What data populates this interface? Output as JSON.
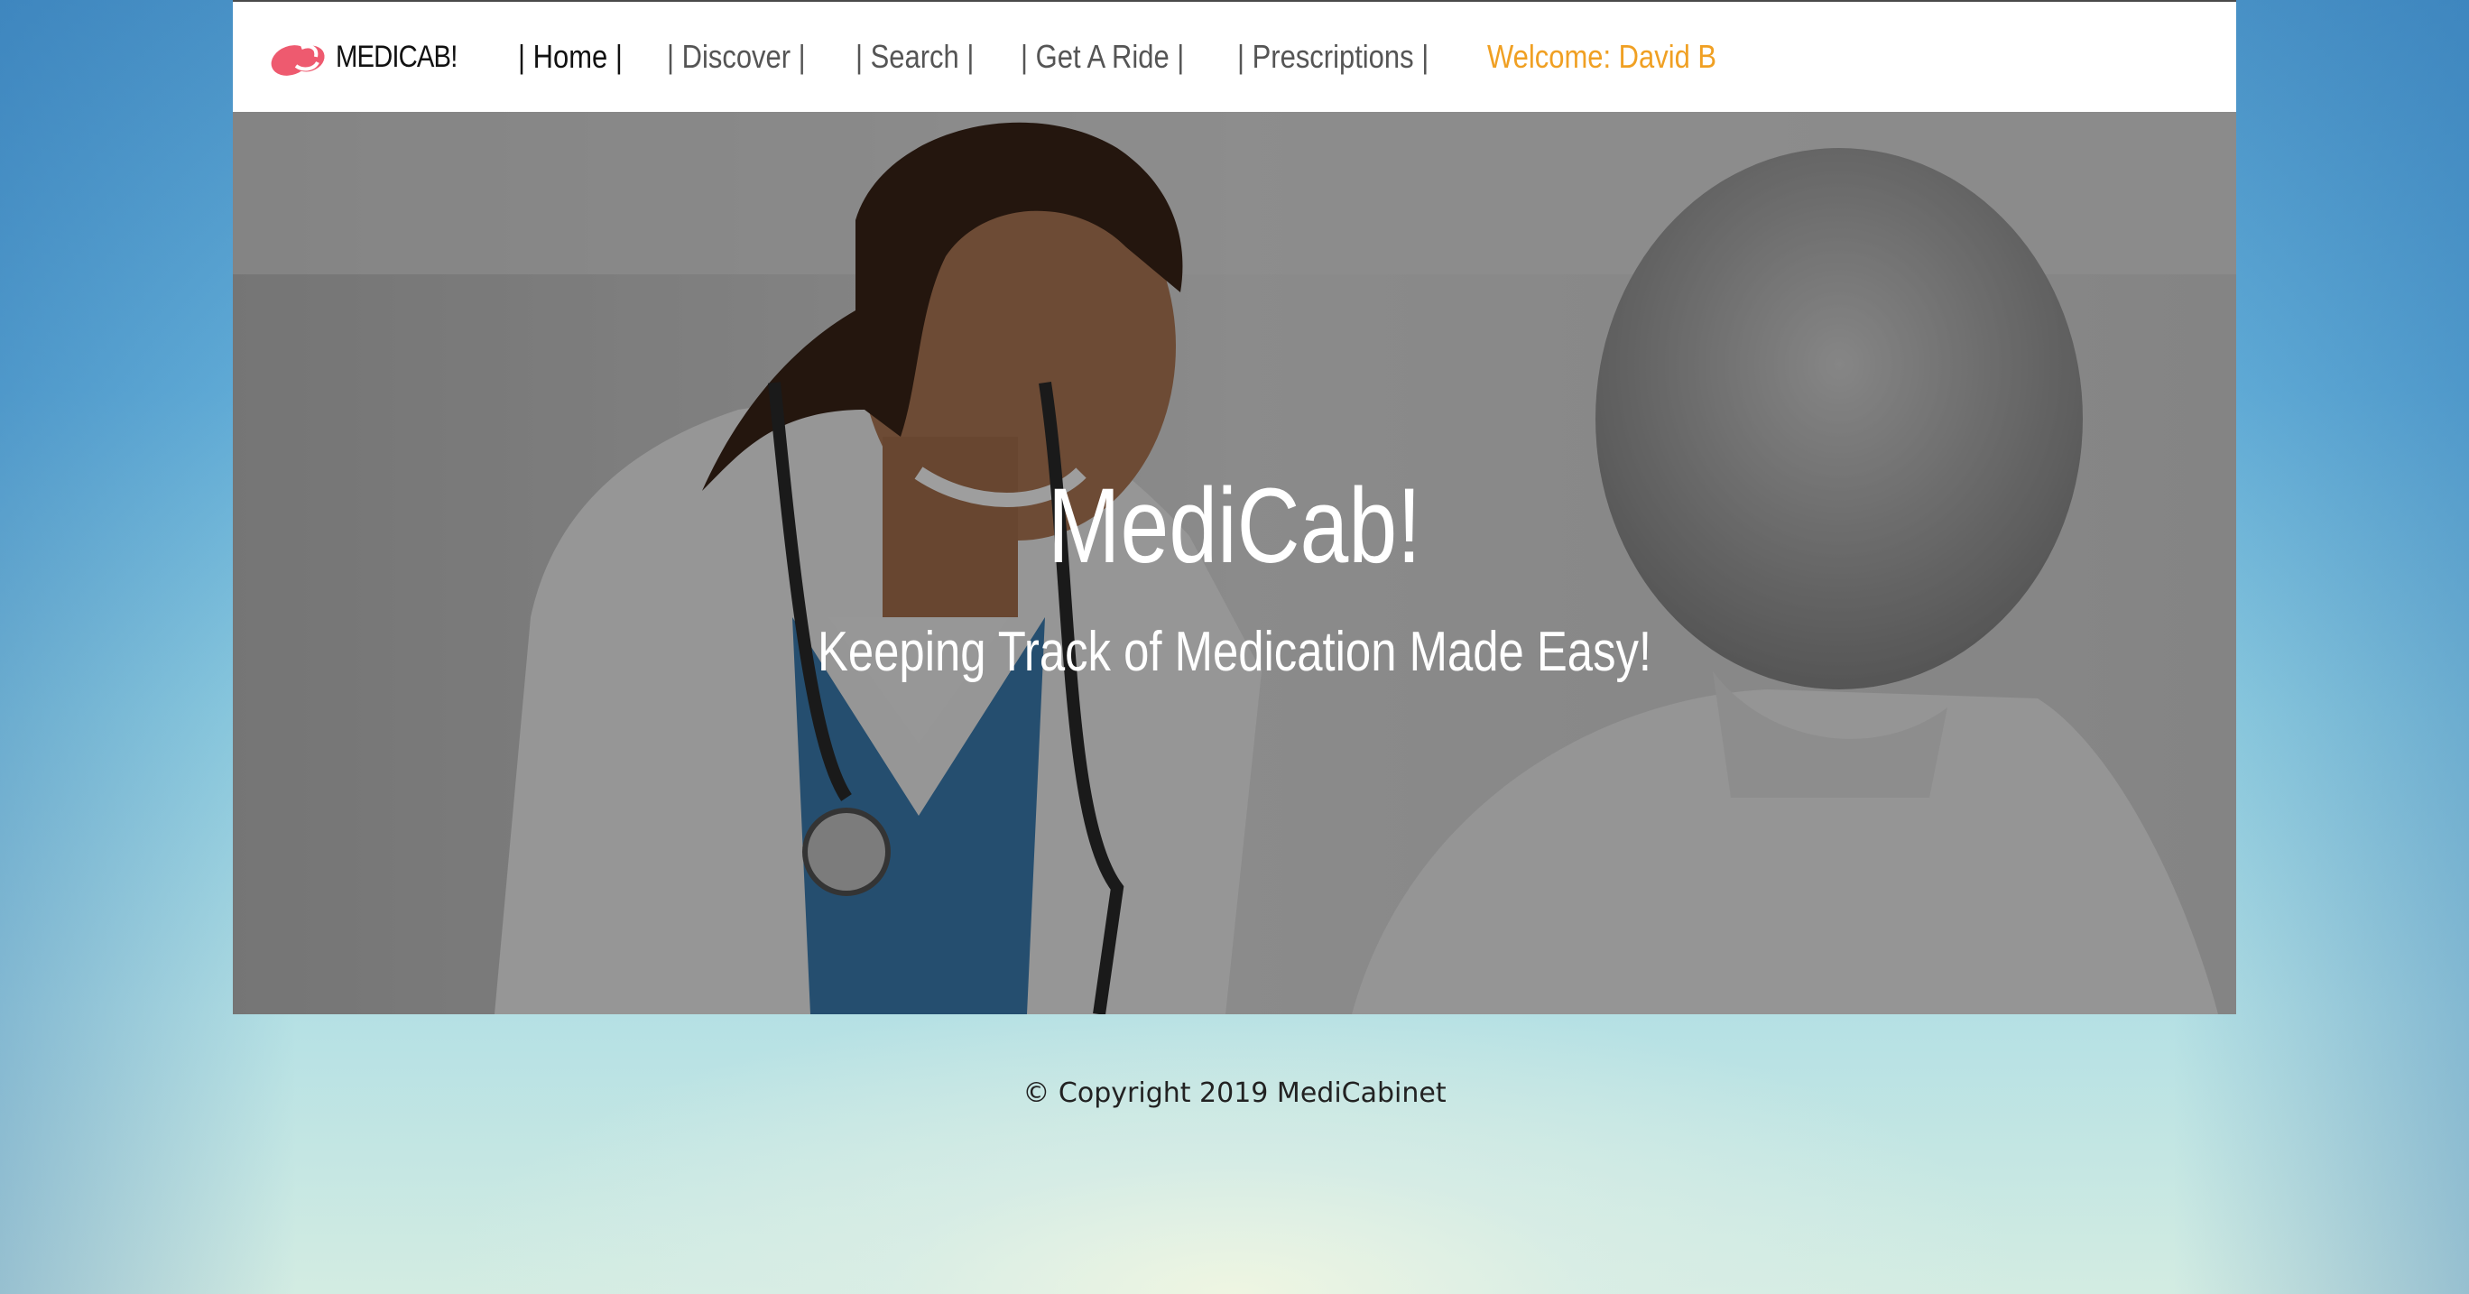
{
  "navbar": {
    "brand": "MEDICAB!",
    "links": [
      {
        "label": "| Home |"
      },
      {
        "label": "| Discover |"
      },
      {
        "label": "| Search |"
      },
      {
        "label": "| Get A Ride |"
      },
      {
        "label": "| Prescriptions |"
      }
    ],
    "welcome": "Welcome: David B"
  },
  "hero": {
    "title": "MediCab!",
    "subtitle": "Keeping Track of Medication Made Easy!"
  },
  "footer": {
    "copyright": "© Copyright 2019 MediCabinet"
  },
  "colors": {
    "accent": "#f0a023",
    "logo": "#ee5a6f"
  }
}
